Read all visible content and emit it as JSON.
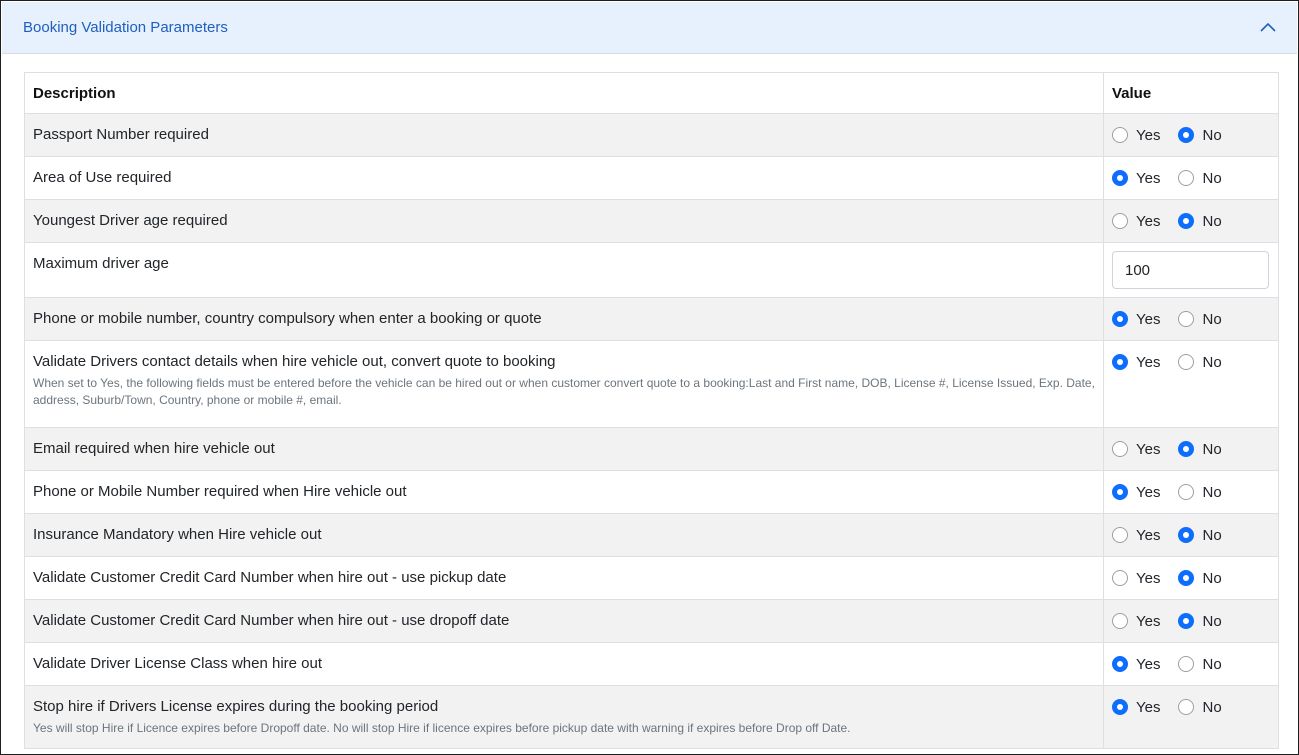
{
  "panel": {
    "title": "Booking Validation Parameters"
  },
  "table": {
    "headers": {
      "description": "Description",
      "value": "Value"
    },
    "yes_label": "Yes",
    "no_label": "No",
    "rows": [
      {
        "label": "Passport Number required",
        "type": "radio",
        "value": "No",
        "note": ""
      },
      {
        "label": "Area of Use required",
        "type": "radio",
        "value": "Yes",
        "note": ""
      },
      {
        "label": "Youngest Driver age required",
        "type": "radio",
        "value": "No",
        "note": ""
      },
      {
        "label": "Maximum driver age",
        "type": "input",
        "value": "100",
        "note": ""
      },
      {
        "label": "Phone or mobile number, country compulsory when enter a booking or quote",
        "type": "radio",
        "value": "Yes",
        "note": ""
      },
      {
        "label": "Validate Drivers contact details when hire vehicle out, convert quote to booking",
        "type": "radio",
        "value": "Yes",
        "note": "When set to Yes, the following fields must be entered before the vehicle can be hired out or when customer convert quote to a booking:Last and First name, DOB, License #, License Issued, Exp. Date, address, Suburb/Town, Country, phone or mobile #, email."
      },
      {
        "label": "Email required when hire vehicle out",
        "type": "radio",
        "value": "No",
        "note": ""
      },
      {
        "label": "Phone or Mobile Number required when Hire vehicle out",
        "type": "radio",
        "value": "Yes",
        "note": ""
      },
      {
        "label": "Insurance Mandatory when Hire vehicle out",
        "type": "radio",
        "value": "No",
        "note": ""
      },
      {
        "label": "Validate Customer Credit Card Number when hire out - use pickup date",
        "type": "radio",
        "value": "No",
        "note": ""
      },
      {
        "label": "Validate Customer Credit Card Number when hire out - use dropoff date",
        "type": "radio",
        "value": "No",
        "note": ""
      },
      {
        "label": "Validate Driver License Class when hire out",
        "type": "radio",
        "value": "Yes",
        "note": ""
      },
      {
        "label": "Stop hire if Drivers License expires during the booking period",
        "type": "radio",
        "value": "Yes",
        "note": "Yes will stop Hire if Licence expires before Dropoff date. No will stop Hire if licence expires before pickup date with warning if expires before Drop off Date."
      }
    ]
  },
  "colors": {
    "accent": "#0d6efd",
    "header_bg": "#e7f0fd",
    "title_color": "#1f5fbf"
  },
  "icons": {
    "collapse": "chevron-up-icon"
  }
}
